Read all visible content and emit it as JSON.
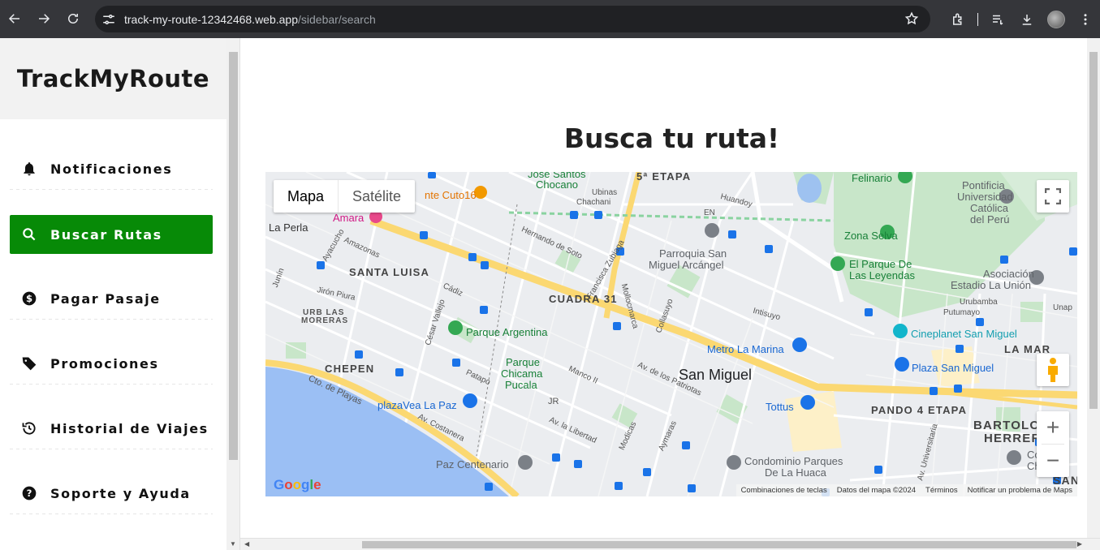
{
  "browser": {
    "url_host": "track-my-route-12342468.web.app",
    "url_path": "/sidebar/search"
  },
  "sidebar": {
    "logo": "TrackMyRoute",
    "items": [
      {
        "label": "Notificaciones",
        "icon": "bell-icon",
        "active": false
      },
      {
        "label": "Buscar Rutas",
        "icon": "search-icon",
        "active": true
      },
      {
        "label": "Pagar Pasaje",
        "icon": "dollar-icon",
        "active": false
      },
      {
        "label": "Promociones",
        "icon": "tag-icon",
        "active": false
      },
      {
        "label": "Historial de Viajes",
        "icon": "history-icon",
        "active": false
      },
      {
        "label": "Soporte y Ayuda",
        "icon": "help-icon",
        "active": false
      }
    ]
  },
  "main": {
    "title": "Busca tu ruta!"
  },
  "map": {
    "type_map": "Mapa",
    "type_satellite": "Satélite",
    "google": "Google",
    "attribution": {
      "shortcuts": "Combinaciones de teclas",
      "data": "Datos del mapa ©2024",
      "terms": "Términos",
      "report": "Notificar un problema de Maps"
    },
    "labels": {
      "san_miguel": "San Miguel",
      "quinta_etapa": "5ª ETAPA",
      "santa_luisa": "SANTA LUISA",
      "cuadra31": "CUADRA 31",
      "chepen": "CHEPEN",
      "la_perla": "La Perla",
      "urb_las": "URB LAS",
      "moreras": "MORERAS",
      "pando": "PANDO 4 ETAPA",
      "la_mar": "LA MAR",
      "bartolo": "BARTOLO",
      "herrera": "HERRER",
      "san": "SAN",
      "parque_argentina": "Parque Argentina",
      "parque": "Parque",
      "chicama": "Chicama",
      "pucala": "Pucala",
      "plazavea": "plazaVea La Paz",
      "paz_centenario": "Paz Centenario",
      "metro": "Metro La Marina",
      "tottus": "Tottus",
      "condominio1": "Condominio Parques",
      "condominio2": "De La Huaca",
      "cineplanet": "Cineplanet San Miguel",
      "plaza_sm": "Plaza San Miguel",
      "parroquia1": "Parroquia San",
      "parroquia2": "Miguel Arcángel",
      "zona_selva": "Zona Selva",
      "parque_ley1": "El Parque De",
      "parque_ley2": "Las Leyendas",
      "felinario": "Felinario",
      "pucp1": "Pontificia",
      "pucp2": "Universidad",
      "pucp3": "Católica",
      "pucp4": "del Perú",
      "asoc1": "Asociación",
      "asoc2": "Estadio La Unión",
      "cuto": "nte Cuto16",
      "amara": "Amara",
      "cole": "Cole",
      "chin": "Chin",
      "jose_santos": "José Santos",
      "chocano": "Chocano",
      "cto_playas": "Cto. de Playas",
      "av_costanera": "Av. Costanera",
      "av_patriotas": "Av. de los Patriotas",
      "av_libertad": "Av. la Libertad",
      "manco": "Manco II",
      "cesar_vallejo": "César Vallejo",
      "universitaria": "Av. Universitaria",
      "jiron_piura": "Jirón Piura",
      "hernando": "Hernando de Soto",
      "francisca": "Francisca Zubiaga",
      "intisuyo": "Intisuyo",
      "urubamba": "Urubamba",
      "putumayo": "Putumayo",
      "amazonas": "Amazonas",
      "patapo": "Patapo",
      "cadiz": "Cádiz",
      "jr": "JR",
      "ubinas": "Ubinas",
      "chachani": "Chachani",
      "huandoy": "Huandoy",
      "mollocmarca": "Mollocmarca",
      "collasuyo": "Collasuyo",
      "aymaras": "Aymaras",
      "modicas": "Modicas",
      "unap": "Unap",
      "en": "EN",
      "ayacucho": "Ayacucho",
      "junin": "Junín"
    }
  }
}
